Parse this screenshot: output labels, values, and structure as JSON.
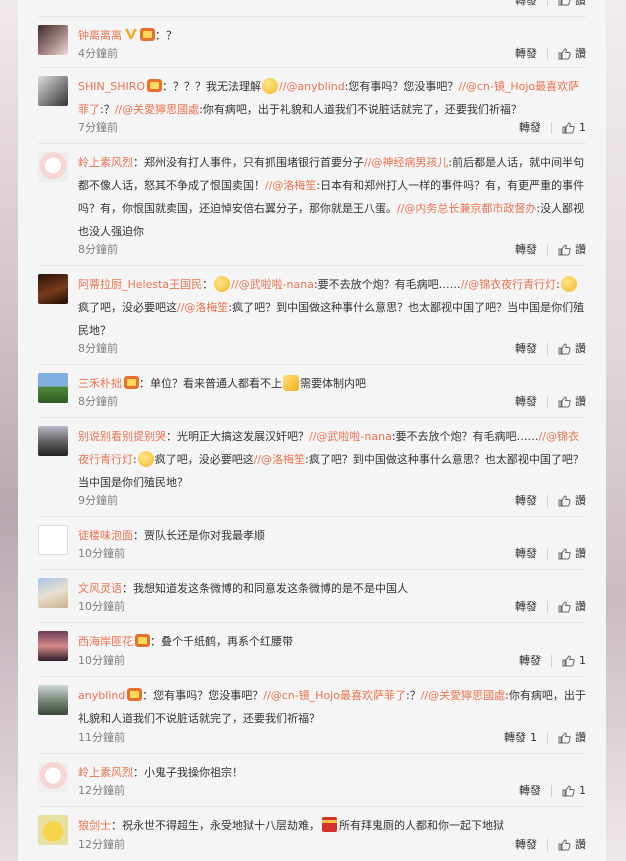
{
  "top": {
    "reply": "轉發",
    "like": "讚"
  },
  "comments": [
    {
      "user": "钟离离离",
      "text_before": "：？",
      "time": "4分鐘前",
      "reply": "轉發",
      "like": "讚",
      "like_count": ""
    },
    {
      "user": "SHIN_SHIRO",
      "p1": "：？？？我无法理解",
      "at1": "//@anyblind",
      "p2": ":您有事吗？您没事吧？",
      "at2": "//@cn-镜_Hojo最喜欢萨菲了",
      "p3": ":？",
      "at3": "//@关愛獰思國處",
      "p4": ":你有病吧，出于礼貌和人道我们不说脏话就完了，还要我们祈福？",
      "time": "7分鐘前",
      "reply": "轉發",
      "like": "讚",
      "like_count": "1"
    },
    {
      "user": "岭上素风烈",
      "p1": "：郑州没有打人事件，只有抓围堵银行首要分子",
      "at1": "//@神经病男孩儿",
      "p2": ":前后都是人话，就中间半句都不像人话，怒其不争成了恨国卖国！",
      "at2": "//@洛梅笙",
      "p3": ":日本有和郑州打人一样的事件吗？有，有更严重的事件吗？有，你恨国就卖国，还迫悼安倍右翼分子，那你就是王八蛋。",
      "at3": "//@内务总长兼京都市政督办",
      "p4": ":没人鄙视也没人强迫你",
      "time": "8分鐘前",
      "reply": "轉發",
      "like": "讚",
      "like_count": ""
    },
    {
      "user": "阿蒂拉厨_Helesta王国民",
      "p1": "：",
      "at1": "//@武啦啦-nana",
      "p2": ":要不去放个炮？有毛病吧……",
      "at2": "//@锦衣夜行青行灯",
      "p3": ":",
      "p3b": "疯了吧，没必要吧这",
      "at3": "//@洛梅笙",
      "p4": ":疯了吧？到中国做这种事什么意思？也太鄙视中国了吧？当中国是你们殖民地？",
      "time": "8分鐘前",
      "reply": "轉發",
      "like": "讚",
      "like_count": ""
    },
    {
      "user": "三禾朴拙",
      "p1": "：单位？看来普通人都看不上",
      "p2": "需要体制内吧",
      "time": "8分鐘前",
      "reply": "轉發",
      "like": "讚",
      "like_count": ""
    },
    {
      "user": "别说别看别提别哭",
      "p1": "：光明正大搞这发展汉奸吧？",
      "at1": "//@武啦啦-nana",
      "p2": ":要不去放个炮？有毛病吧……",
      "at2": "//@锦衣夜行青行灯",
      "p3": ":",
      "p3b": "疯了吧，没必要吧这",
      "at3": "//@洛梅笙",
      "p4": ":疯了吧？到中国做这种事什么意思？也太鄙视中国了吧？当中国是你们殖民地？",
      "time": "9分鐘前",
      "reply": "轉發",
      "like": "讚",
      "like_count": ""
    },
    {
      "user": "徒楼味泡面",
      "p1": "：贾队长还是你对我最孝顺",
      "time": "10分鐘前",
      "reply": "轉發",
      "like": "讚",
      "like_count": ""
    },
    {
      "user": "文风灵语",
      "p1": "：我想知道发这条微博的和同意发这条微博的是不是中国人",
      "time": "10分鐘前",
      "reply": "轉發",
      "like": "讚",
      "like_count": ""
    },
    {
      "user": "西海岸匪花",
      "p1": "：叠个千纸鹤，再系个红腰带",
      "time": "10分鐘前",
      "reply": "轉發",
      "like": "讚",
      "like_count": "1"
    },
    {
      "user": "anyblind",
      "p1": "：您有事吗？您没事吧？",
      "at1": "//@cn-镜_Hojo最喜欢萨菲了",
      "p2": ":？",
      "at2": "//@关愛獰思國處",
      "p3": ":你有病吧，出于礼貌和人道我们不说脏话就完了，还要我们祈福？",
      "time": "11分鐘前",
      "reply": "轉發",
      "reply_count": "1",
      "like": "讚",
      "like_count": ""
    },
    {
      "user": "岭上素风烈",
      "p1": "：小鬼子我操你祖宗！",
      "time": "12分鐘前",
      "reply": "轉發",
      "like": "讚",
      "like_count": "1"
    },
    {
      "user": "狼剑士",
      "p1": "：祝永世不得超生，永受地狱十八层劫难，",
      "p2": "所有拜鬼厕的人都和你一起下地狱",
      "time": "12分鐘前",
      "reply": "轉發",
      "like": "讚",
      "like_count": ""
    }
  ],
  "icons": {
    "like": "thumbs-up-icon",
    "vip": "v-badge-icon",
    "crown": "crown-badge-icon"
  },
  "colors": {
    "username": "#eb7350",
    "text": "#333333",
    "meta": "#808080",
    "panel": "#f5f5f5"
  }
}
